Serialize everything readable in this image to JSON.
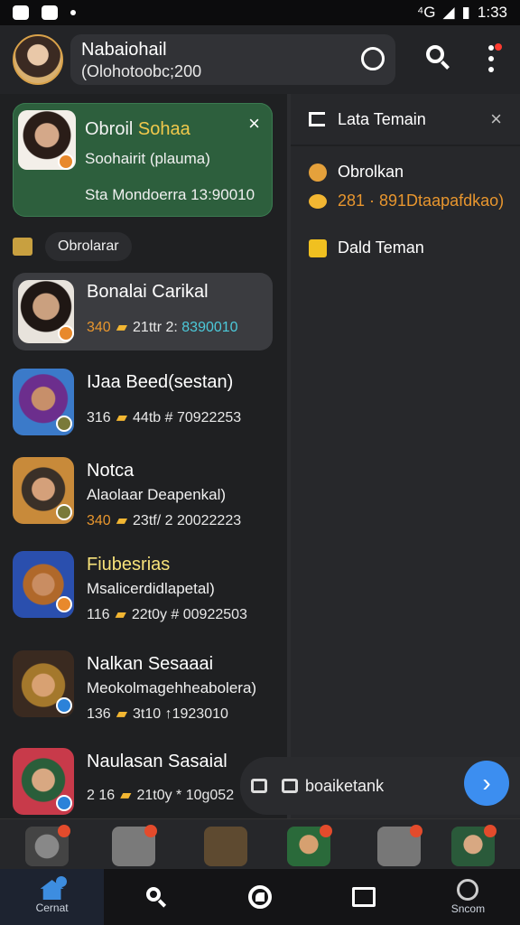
{
  "status_bar": {
    "time": "1:33",
    "network": "⁴G"
  },
  "header": {
    "name": "Nabaiohail",
    "subtitle": "(Olohotoobc;200"
  },
  "featured_chat": {
    "title_part1": "Obroil ",
    "title_part2": "Sohaa",
    "subtitle": "Soohairit (plauma)",
    "meta": "Sta Mondoerra 13:90010",
    "close": "×"
  },
  "filter": {
    "chip_label": "Obrolarar"
  },
  "chats": [
    {
      "name": "Bonalai Carikal",
      "meta_a": "340",
      "meta_b": "21ttr 2:",
      "meta_c": "8390010"
    },
    {
      "name": "IJaa Beed(sestan)",
      "meta_a": "316",
      "meta_b": "44tb # 70922253",
      "meta_c": ""
    },
    {
      "name": "Notca",
      "msg": "Alaolaar Deapenkal)",
      "meta_a": "340",
      "meta_b": "23tf/ 2 20022223",
      "meta_c": ""
    },
    {
      "name": "Fiubesrias",
      "msg": "Msalicerdidlapetal)",
      "meta_a": "116",
      "meta_b": "22t0y # 00922503",
      "meta_c": ""
    },
    {
      "name": "Nalkan Sesaaai",
      "msg": "Meokolmagehheabolera)",
      "meta_a": "136",
      "meta_b": "3t10 ↑",
      "meta_c": "1923010"
    },
    {
      "name": "Naulasan Sasaial",
      "meta_a": "2 16",
      "meta_b": "21t0y * 10g052",
      "meta_c": ""
    }
  ],
  "right_panel": {
    "title": "Lata Temain",
    "close": "×",
    "item1": "Obrolkan",
    "item1_sub": "281 · 891Dtaapafdkao)",
    "item2": "Dald Teman"
  },
  "compose": {
    "placeholder": "boaiketank",
    "send": "›"
  },
  "bottom_nav": [
    {
      "label": "Cernat",
      "icon": "home-icon"
    },
    {
      "label": "",
      "icon": "search-icon"
    },
    {
      "label": "",
      "icon": "timer-icon"
    },
    {
      "label": "",
      "icon": "book-icon"
    },
    {
      "label": "Sncom",
      "icon": "profile-icon"
    }
  ]
}
